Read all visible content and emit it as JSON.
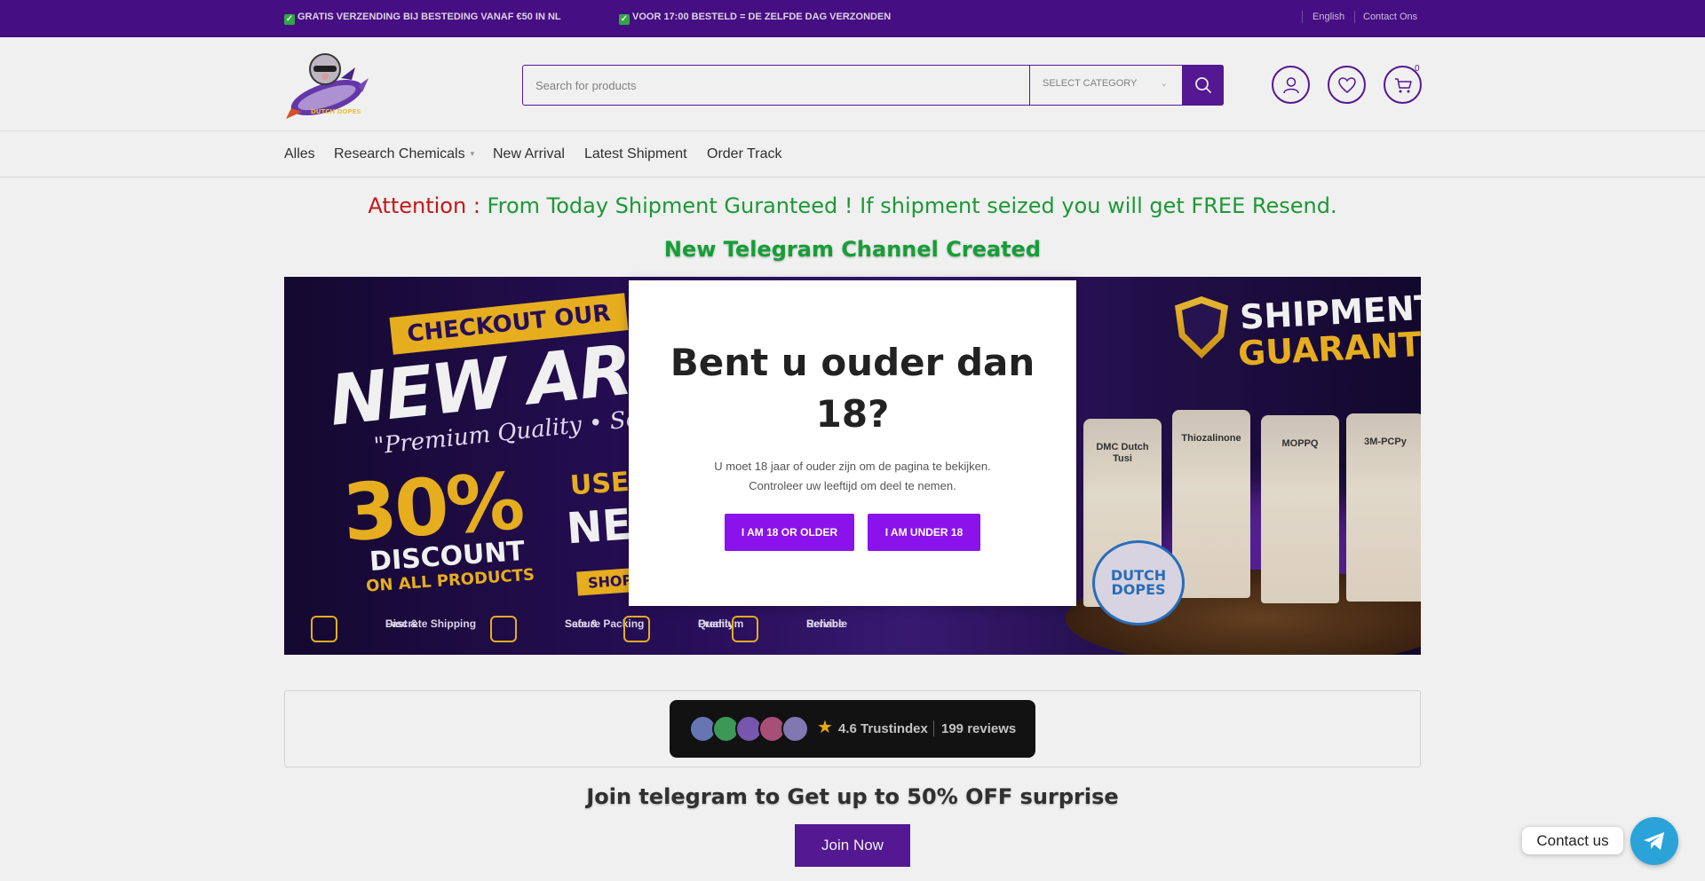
{
  "topbar": {
    "promo_1": "GRATIS VERZENDING BIJ BESTEDING VANAF €50 IN NL",
    "promo_2": "VOOR 17:00 BESTELD = DE ZELFDE DAG VERZONDEN",
    "language": "English",
    "contact": "Contact Ons",
    "colors": {
      "background": "#4b0f8c"
    }
  },
  "header": {
    "search": {
      "placeholder": "Search for products"
    },
    "category": {
      "selected": "SELECT CATEGORY"
    },
    "cart": {
      "count": "0"
    },
    "icons": [
      "account-icon",
      "heart-icon",
      "cart-icon",
      "search-icon"
    ],
    "colors": {
      "accent": "#5a1a9c"
    }
  },
  "nav": {
    "items": [
      {
        "label": "Alles"
      },
      {
        "label": "Research Chemicals"
      },
      {
        "label": "New Arrival"
      },
      {
        "label": "Latest Shipment"
      },
      {
        "label": "Order Track"
      }
    ]
  },
  "notice": {
    "attention_label": "Attention :",
    "attention_text": "From Today Shipment Guranteed ! If shipment seized you will get FREE Resend.",
    "telegram_text": "New Telegram Channel Created",
    "colors": {
      "attention": "#d11a1a",
      "message": "#1fa23a"
    }
  },
  "banner": {
    "checkout": "CHECKOUT OUR",
    "new_arrival": "NEW ARRIVA",
    "premium": "\"Premium Quality • Sealed & S",
    "discount_percent": "30%",
    "discount": "DISCOUNT",
    "on_all": "ON ALL PRODUCTS",
    "use_code": "USE C",
    "new_code": "NEW",
    "shop": "SHOP",
    "features": [
      {
        "line1": "Fast &",
        "line2": "Discrete Shipping"
      },
      {
        "line1": "Safe &",
        "line2": "Secure Packing"
      },
      {
        "line1": "Premium",
        "line2": "Quality"
      },
      {
        "line1": "Reliable",
        "line2": "Service"
      }
    ],
    "shipment": "SHIPMENT",
    "guarantee": "GUARANTEE",
    "bags": [
      {
        "name": "DMC Dutch Tusi"
      },
      {
        "name": "Thiozalinone"
      },
      {
        "name": "MOPPQ"
      },
      {
        "name": "3M-PCPy"
      }
    ],
    "brand_badge": "DUTCH DOPES"
  },
  "trust": {
    "rating": "4.6 Trustindex",
    "reviews": "199 reviews",
    "avatar_colors": [
      "#6d7dbf",
      "#3fa35b",
      "#7e5db8",
      "#b2547e",
      "#8a7fbd"
    ],
    "colors": {
      "star": "#f7b500"
    }
  },
  "join": {
    "title": "Join telegram to Get up to 50% OFF surprise",
    "button": "Join Now"
  },
  "age_modal": {
    "title": "Bent u ouder dan 18?",
    "message_line_1": "U moet 18 jaar of ouder zijn om de pagina te bekijken.",
    "message_line_2": "Controleer uw leeftijd om deel te nemen.",
    "confirm_button": "I AM 18 OR OLDER",
    "deny_button": "I AM UNDER 18",
    "colors": {
      "button": "#8a12ea"
    }
  },
  "contact_widget": {
    "label": "Contact us",
    "icon": "telegram-icon",
    "colors": {
      "circle": "#2aa3d8"
    }
  }
}
